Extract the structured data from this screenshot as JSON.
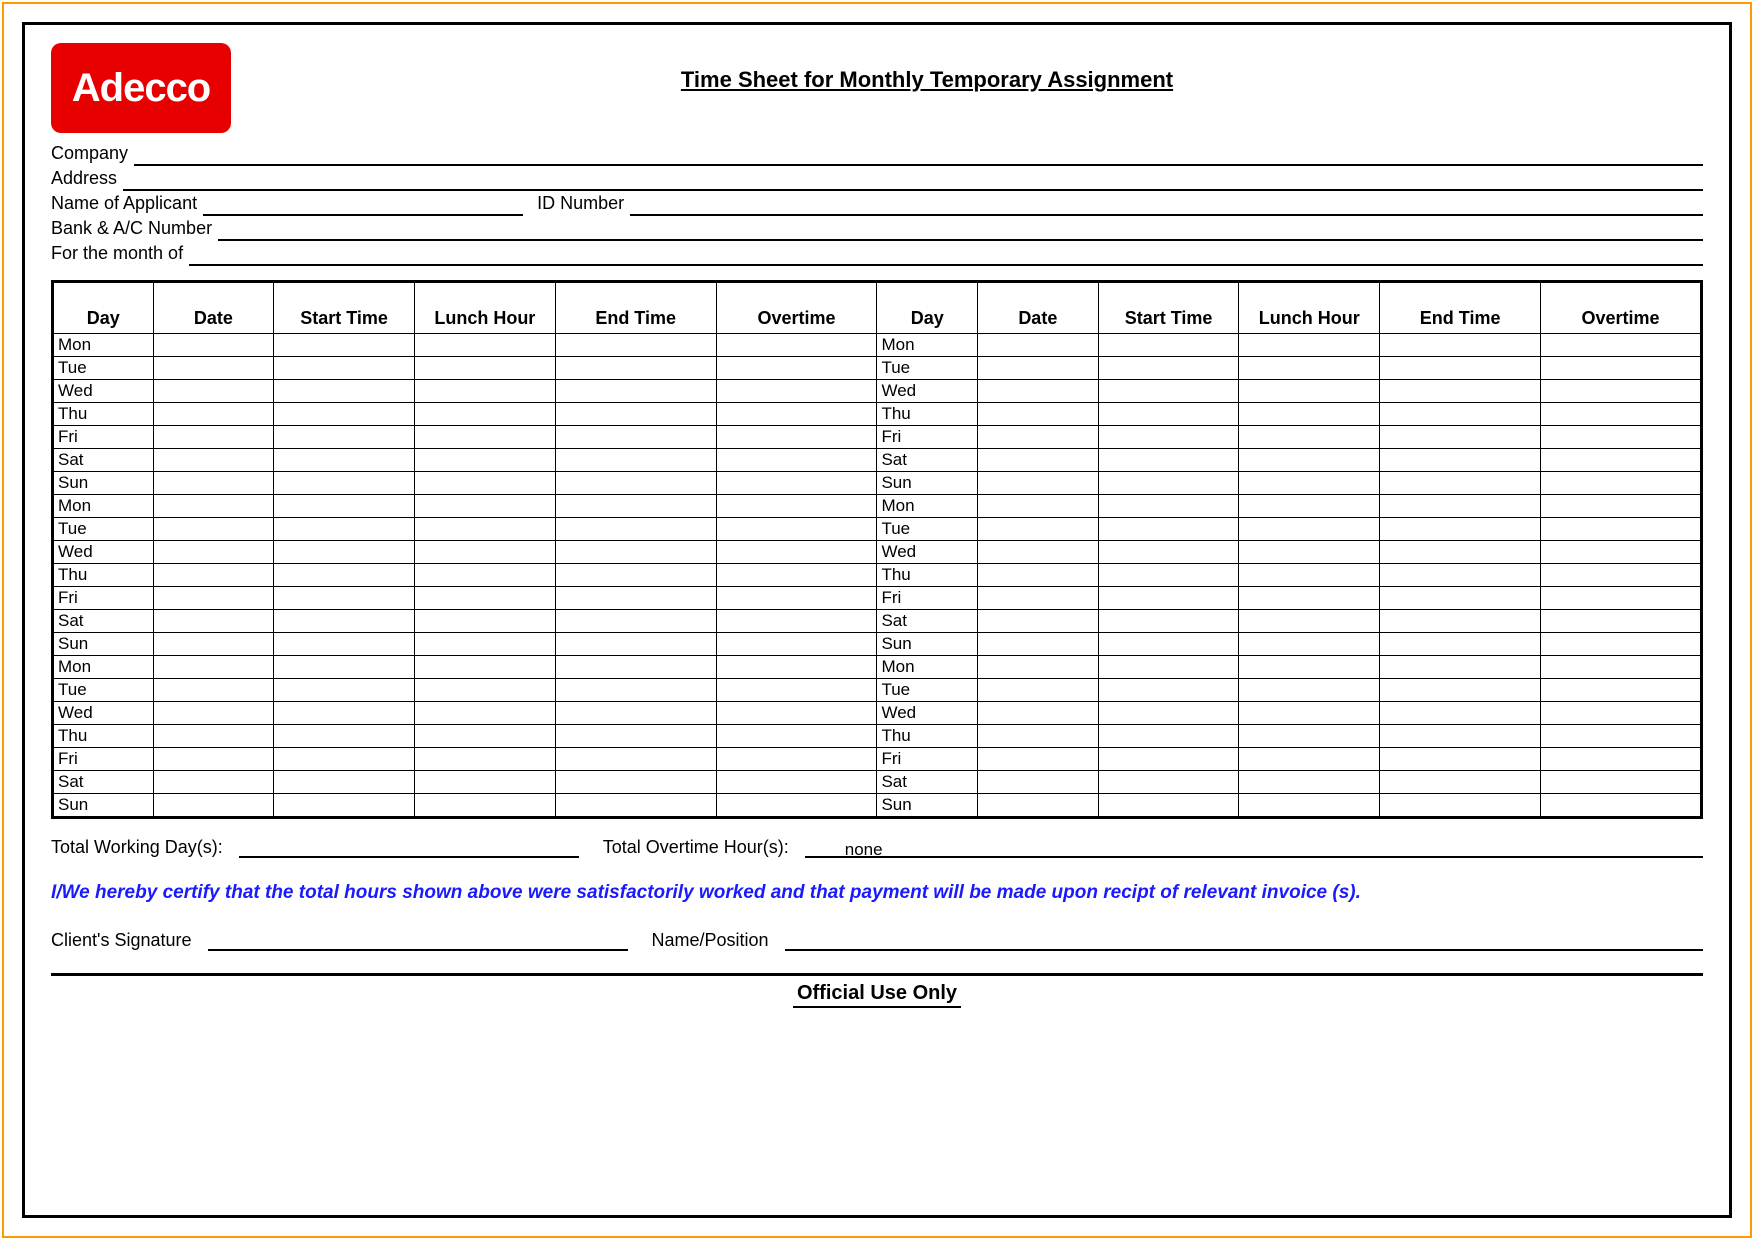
{
  "logo_text": "Adecco",
  "title": "Time Sheet for Monthly Temporary Assignment",
  "info": {
    "company": "Company",
    "address": "Address",
    "applicant": "Name of Applicant",
    "id_number": "ID Number",
    "bank": "Bank & A/C Number",
    "month": "For the month of"
  },
  "headers": {
    "day": "Day",
    "date": "Date",
    "start": "Start Time",
    "lunch": "Lunch Hour",
    "end": "End Time",
    "overtime": "Overtime"
  },
  "days_left": [
    "Mon",
    "Tue",
    "Wed",
    "Thu",
    "Fri",
    "Sat",
    "Sun",
    "Mon",
    "Tue",
    "Wed",
    "Thu",
    "Fri",
    "Sat",
    "Sun",
    "Mon",
    "Tue",
    "Wed",
    "Thu",
    "Fri",
    "Sat",
    "Sun"
  ],
  "days_right": [
    "Mon",
    "Tue",
    "Wed",
    "Thu",
    "Fri",
    "Sat",
    "Sun",
    "Mon",
    "Tue",
    "Wed",
    "Thu",
    "Fri",
    "Sat",
    "Sun",
    "Mon",
    "Tue",
    "Wed",
    "Thu",
    "Fri",
    "Sat",
    "Sun"
  ],
  "summary": {
    "total_days_label": "Total Working Day(s):",
    "total_days_value": "",
    "total_ot_label": "Total Overtime Hour(s):",
    "total_ot_value": "none"
  },
  "certify_text": "I/We hereby certify that the total hours shown above were satisfactorily worked and that payment will be made upon recipt of relevant invoice (s).",
  "signature": {
    "client_sig": "Client's Signature",
    "name_pos": "Name/Position"
  },
  "official_use": "Official Use Only"
}
